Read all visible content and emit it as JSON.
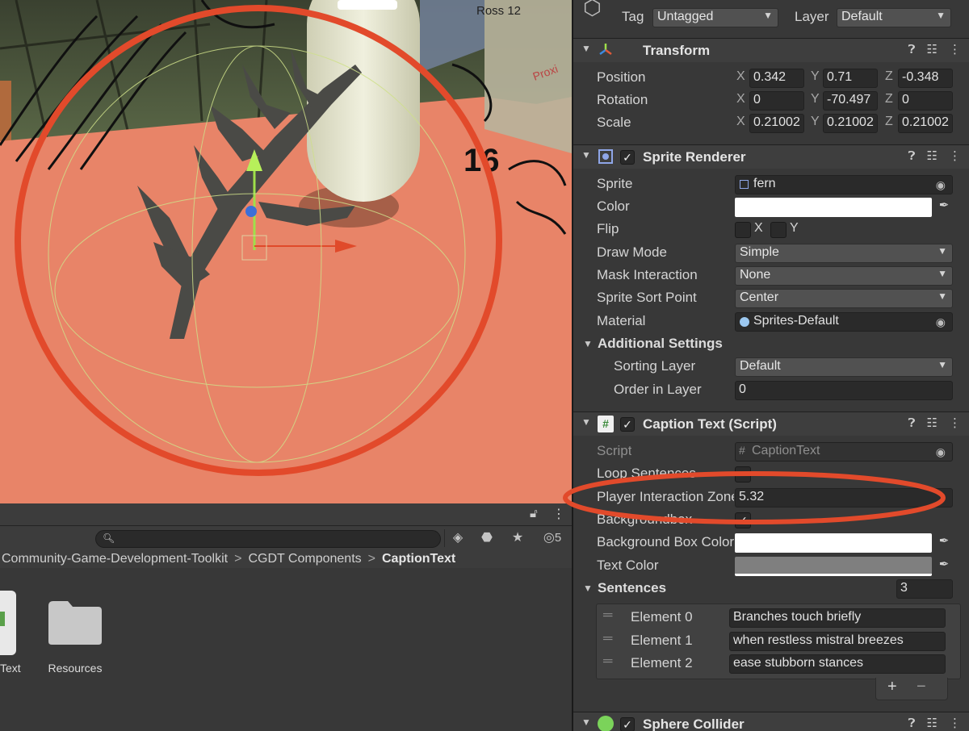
{
  "scene": {
    "sign_label": "Ross 12",
    "sign_label_2": "Proxi",
    "map_number": "16"
  },
  "project": {
    "hidden_count": "5",
    "breadcrumb": [
      "Community-Game-Development-Toolkit",
      "CGDT Components",
      "CaptionText"
    ],
    "assets": [
      {
        "name": "Text"
      },
      {
        "name": "Resources"
      }
    ]
  },
  "inspector": {
    "tag_label": "Tag",
    "tag_value": "Untagged",
    "layer_label": "Layer",
    "layer_value": "Default",
    "transform": {
      "title": "Transform",
      "position_label": "Position",
      "rotation_label": "Rotation",
      "scale_label": "Scale",
      "axes": [
        "X",
        "Y",
        "Z"
      ],
      "position": [
        "0.342",
        "0.71",
        "-0.348"
      ],
      "rotation": [
        "0",
        "-70.497",
        "0"
      ],
      "scale": [
        "0.21002",
        "0.21002",
        "0.21002"
      ]
    },
    "sprite_renderer": {
      "title": "Sprite Renderer",
      "sprite_label": "Sprite",
      "sprite_value": "fern",
      "color_label": "Color",
      "color_value": "#ffffff",
      "flip_label": "Flip",
      "flip_x": "X",
      "flip_y": "Y",
      "draw_mode_label": "Draw Mode",
      "draw_mode_value": "Simple",
      "mask_label": "Mask Interaction",
      "mask_value": "None",
      "sort_point_label": "Sprite Sort Point",
      "sort_point_value": "Center",
      "material_label": "Material",
      "material_value": "Sprites-Default",
      "additional_label": "Additional Settings",
      "sorting_layer_label": "Sorting Layer",
      "sorting_layer_value": "Default",
      "order_label": "Order in Layer",
      "order_value": "0"
    },
    "caption_text": {
      "title": "Caption Text (Script)",
      "script_label": "Script",
      "script_value": "CaptionText",
      "loop_label": "Loop Sentences",
      "zone_label": "Player Interaction Zone",
      "zone_value": "5.32",
      "bgbox_label": "Backgroundbox",
      "bgbox_color_label": "Background Box Color",
      "bgbox_color": "#ffffff",
      "text_color_label": "Text Color",
      "text_color": "#7f7f7f",
      "sentences_label": "Sentences",
      "sentences_count": "3",
      "elements": [
        {
          "name": "Element 0",
          "value": "Branches touch briefly"
        },
        {
          "name": "Element 1",
          "value": "when restless mistral breezes"
        },
        {
          "name": "Element 2",
          "value": "ease stubborn stances"
        }
      ]
    },
    "sphere_collider": {
      "title": "Sphere Collider"
    }
  },
  "colors": {
    "accent_annotation": "#e24a2b",
    "floor": "#e88468",
    "panel": "#383838"
  }
}
